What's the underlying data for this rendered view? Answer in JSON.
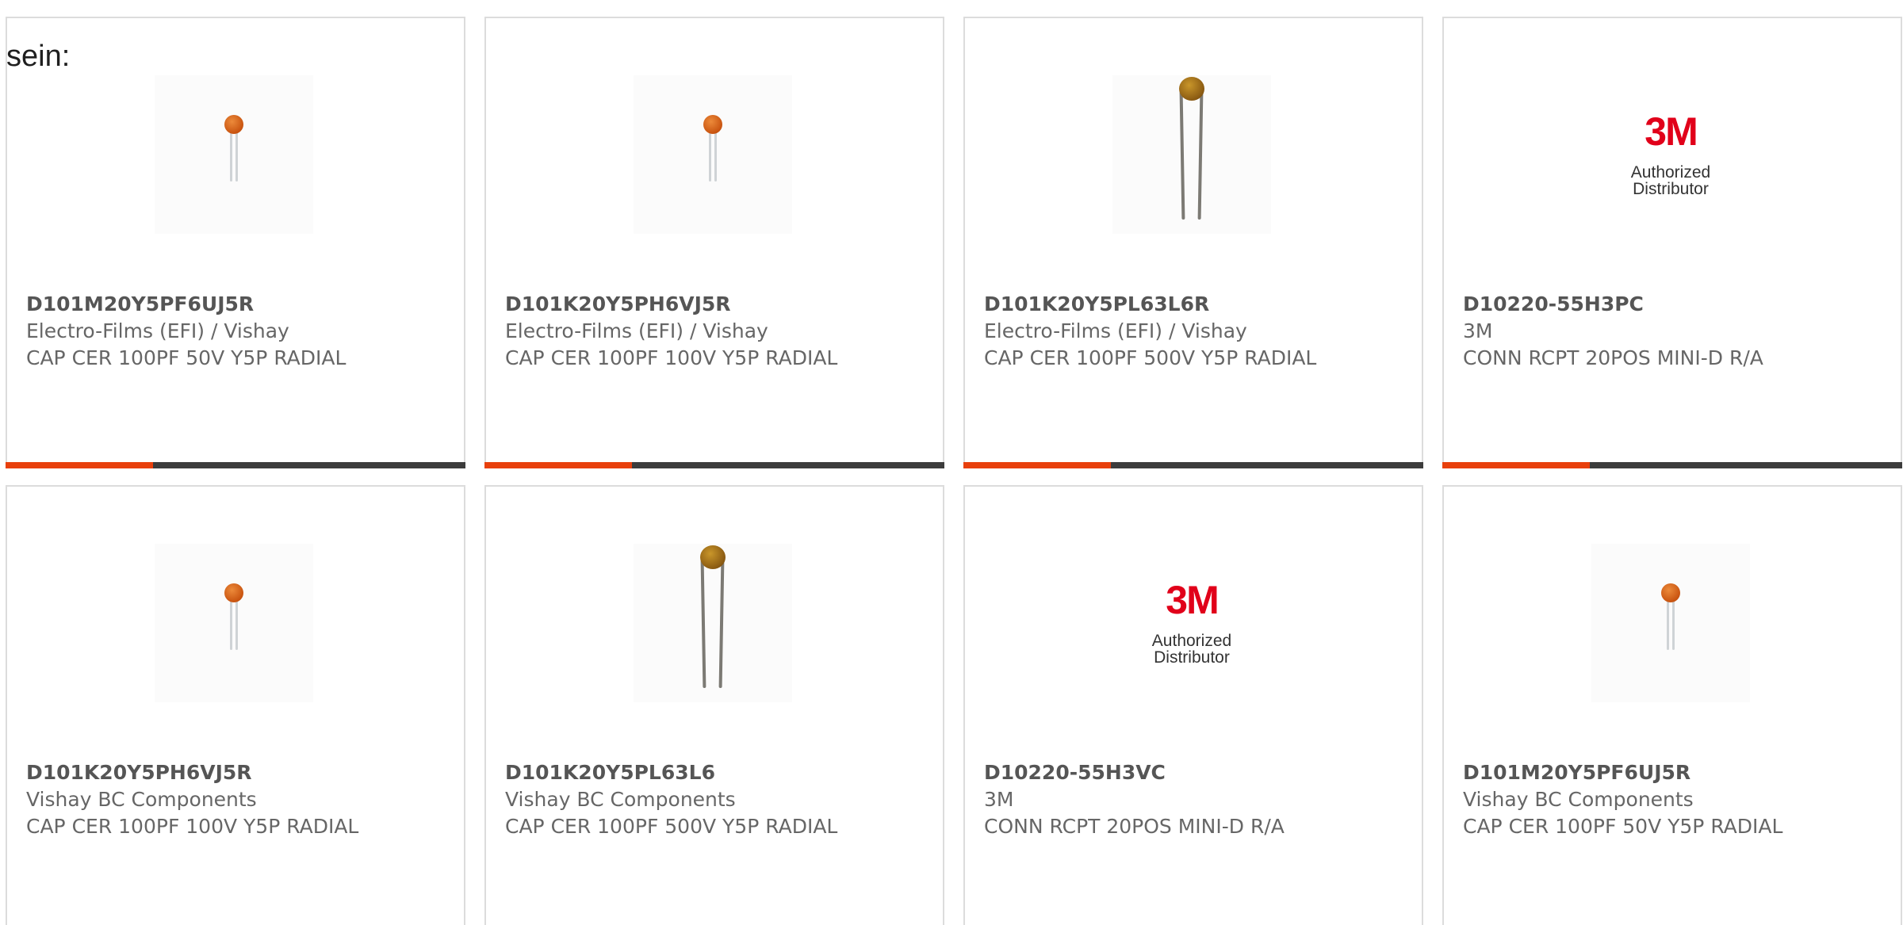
{
  "intro_text": "sein:",
  "accent_color": "#e8400c",
  "bar_track_color": "#3c3c3c",
  "cards": [
    {
      "part_number": "D101M20Y5PF6UJ5R",
      "manufacturer": "Electro-Films (EFI) / Vishay",
      "description": "CAP CER 100PF 50V Y5P RADIAL",
      "image": "small-ceramic-capacitor",
      "progress": 0.32
    },
    {
      "part_number": "D101K20Y5PH6VJ5R",
      "manufacturer": "Electro-Films (EFI) / Vishay",
      "description": "CAP CER 100PF 100V Y5P RADIAL",
      "image": "small-ceramic-capacitor",
      "progress": 0.32
    },
    {
      "part_number": "D101K20Y5PL63L6R",
      "manufacturer": "Electro-Films (EFI) / Vishay",
      "description": "CAP CER 100PF 500V Y5P RADIAL",
      "image": "long-lead-ceramic-capacitor",
      "progress": 0.32
    },
    {
      "part_number": "D10220-55H3PC",
      "manufacturer": "3M",
      "description": "CONN RCPT 20POS MINI-D R/A",
      "image": "3m-logo",
      "logo_brand": "3M",
      "logo_caption": "Authorized Distributor",
      "progress": 0.32
    },
    {
      "part_number": "D101K20Y5PH6VJ5R",
      "manufacturer": "Vishay BC Components",
      "description": "CAP CER 100PF 100V Y5P RADIAL",
      "image": "small-ceramic-capacitor"
    },
    {
      "part_number": "D101K20Y5PL63L6",
      "manufacturer": "Vishay BC Components",
      "description": "CAP CER 100PF 500V Y5P RADIAL",
      "image": "long-lead-ceramic-capacitor"
    },
    {
      "part_number": "D10220-55H3VC",
      "manufacturer": "3M",
      "description": "CONN RCPT 20POS MINI-D R/A",
      "image": "3m-logo",
      "logo_brand": "3M",
      "logo_caption": "Authorized Distributor"
    },
    {
      "part_number": "D101M20Y5PF6UJ5R",
      "manufacturer": "Vishay BC Components",
      "description": "CAP CER 100PF 50V Y5P RADIAL",
      "image": "small-ceramic-capacitor"
    }
  ]
}
